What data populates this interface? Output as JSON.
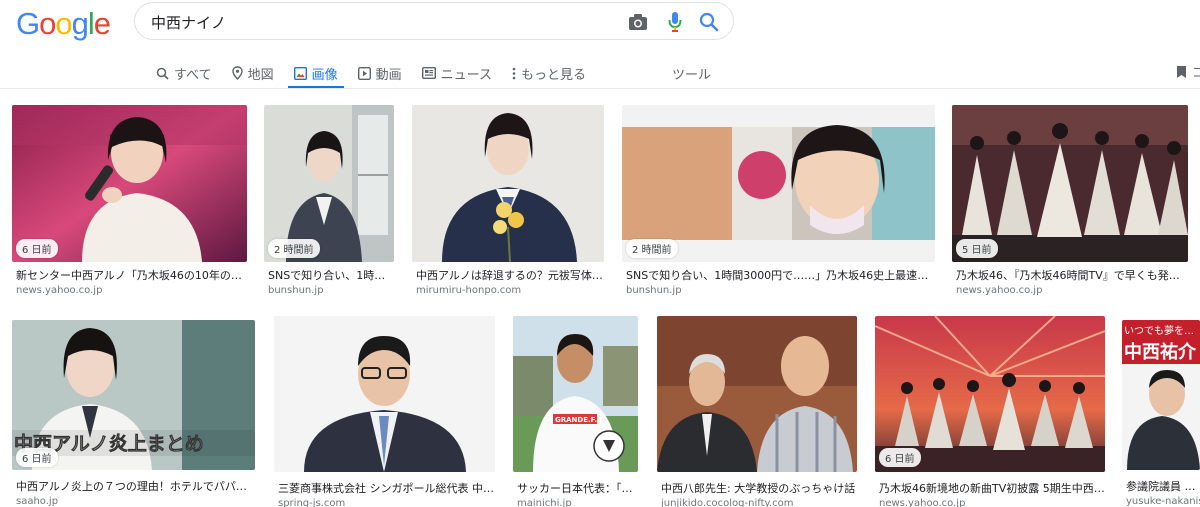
{
  "logo": {
    "letters": [
      "G",
      "o",
      "o",
      "g",
      "l",
      "e"
    ],
    "colors": [
      "#4285F4",
      "#EA4335",
      "#FBBC05",
      "#4285F4",
      "#34A853",
      "#EA4335"
    ]
  },
  "search": {
    "query": "中西ナイノ"
  },
  "tabs": [
    {
      "label": "すべて",
      "icon": "search-icon"
    },
    {
      "label": "地図",
      "icon": "map-pin-icon"
    },
    {
      "label": "画像",
      "icon": "image-icon",
      "active": true
    },
    {
      "label": "動画",
      "icon": "video-icon"
    },
    {
      "label": "ニュース",
      "icon": "news-icon"
    },
    {
      "label": "もっと見る",
      "icon": "more-vert-icon"
    }
  ],
  "tools_label": "ツール",
  "saved_label": "コ",
  "accent": "#1a73e8",
  "results": [
    {
      "badge": "6 日前",
      "title": "新センター中西アルノ「乃木坂46の10年の歴…",
      "domain": "news.yahoo.co.jp"
    },
    {
      "badge": "2 時間前",
      "title": "SNSで知り合い、1時間…",
      "domain": "bunshun.jp"
    },
    {
      "badge": "",
      "title": "中西アルノは辞退するの？元祓写体…",
      "domain": "mirumiru-honpo.com"
    },
    {
      "badge": "2 時間前",
      "title": "SNSで知り合い、1時間3000円で……」乃木坂46史上最速でセ…",
      "domain": "bunshun.jp"
    },
    {
      "badge": "5 日前",
      "title": "乃木坂46、『乃木坂46時間TV』で早くも発揮…",
      "domain": "news.yahoo.co.jp"
    },
    {
      "badge": "6 日前",
      "title": "中西アルノ炎上の７つの理由！ホテルでパパ活…",
      "domain": "saaho.jp"
    },
    {
      "badge": "",
      "title": "三菱商事株式会社 シンガポール総代表 中西…",
      "domain": "spring-js.com"
    },
    {
      "badge": "",
      "title": "サッカー日本代表：「…",
      "domain": "mainichi.jp"
    },
    {
      "badge": "",
      "title": "中西八郎先生: 大学教授のぶっちゃけ話",
      "domain": "junjikido.cocolog-nifty.com"
    },
    {
      "badge": "6 日前",
      "title": "乃木坂46新境地の新曲TV初披露 5期生中西ア…",
      "domain": "news.yahoo.co.jp"
    },
    {
      "badge": "",
      "title": "参議院議員 中西…",
      "domain": "yusuke-nakanishi…"
    }
  ],
  "overlay_texts": {
    "r5_caption": "中西アルノ炎上まとめ",
    "r7_shirt": "GRANDE.F.P",
    "r10_top": "いつでも夢を…",
    "r10_name": "中西祐介"
  }
}
